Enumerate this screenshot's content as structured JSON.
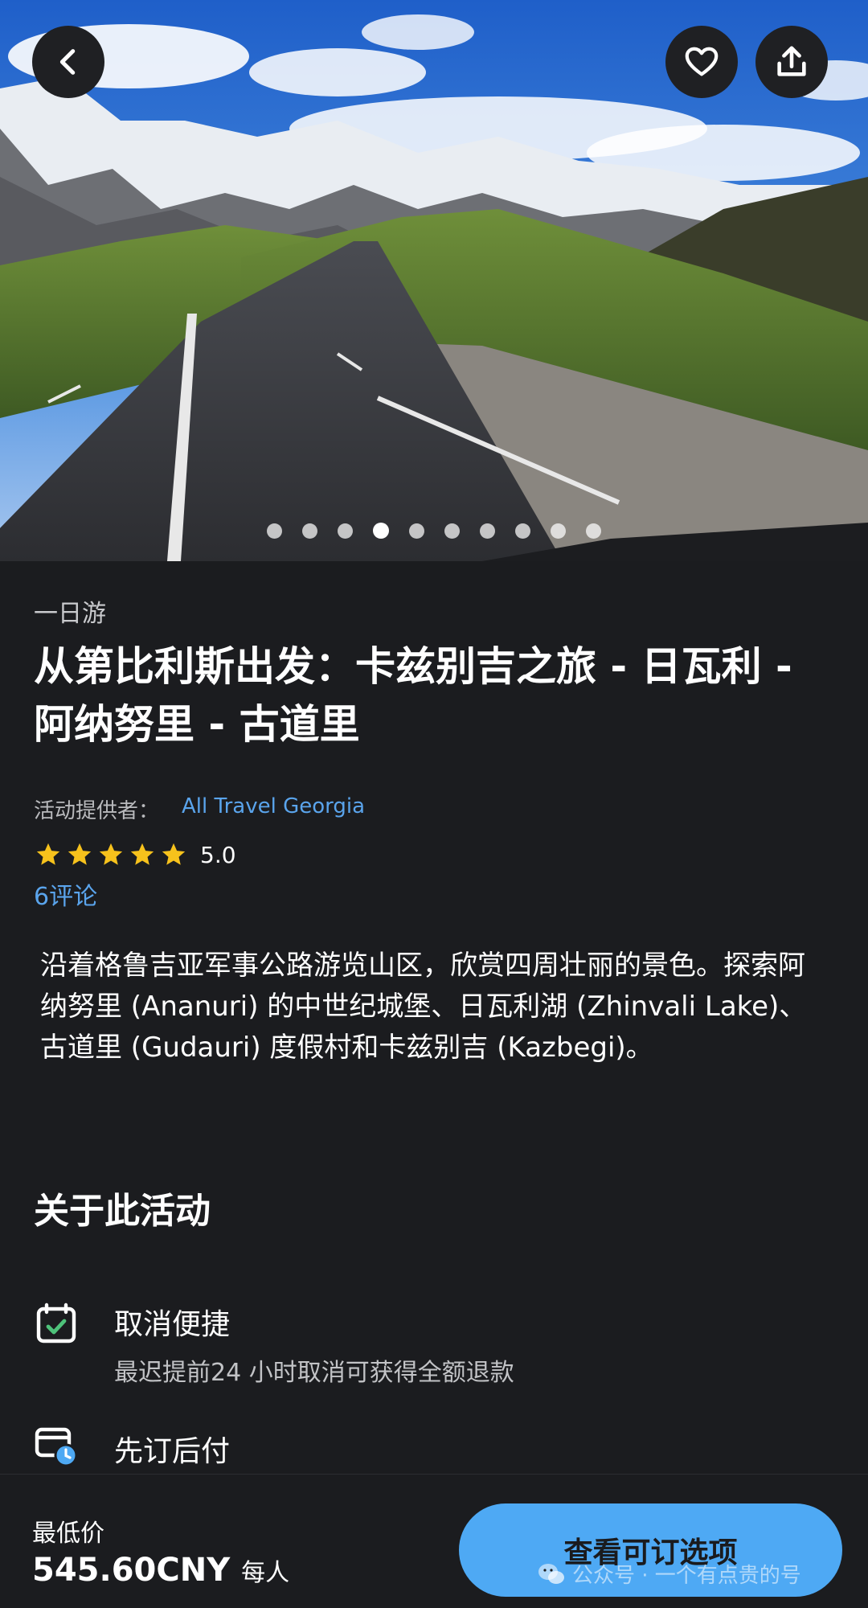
{
  "hero": {
    "image_alt": "mountain road",
    "carousel_total": 10,
    "carousel_active_index": 3
  },
  "category": "一日游",
  "title": "从第比利斯出发：卡兹别吉之旅 - 日瓦利 - 阿纳努里 - 古道里",
  "provider": {
    "label": "活动提供者：",
    "name": "All Travel Georgia"
  },
  "rating": {
    "stars": 5,
    "score": "5.0",
    "reviews": "6评论"
  },
  "description": "沿着格鲁吉亚军事公路游览山区，欣赏四周壮丽的景色。探索阿纳努里 (Ananuri) 的中世纪城堡、日瓦利湖 (Zhinvali Lake)、古道里 (Gudauri) 度假村和卡兹别吉 (Kazbegi)。",
  "about": {
    "title": "关于此活动",
    "features": [
      {
        "icon": "calendar-check-icon",
        "title": "取消便捷",
        "subtitle": "最迟提前24 小时取消可获得全额退款"
      },
      {
        "icon": "card-clock-icon",
        "title": "先订后付",
        "subtitle": ""
      }
    ]
  },
  "booking": {
    "price_label": "最低价",
    "price": "545.60CNY",
    "price_unit": "每人",
    "cta": "查看可订选项"
  },
  "watermark": "公众号 · 一个有点贵的号",
  "colors": {
    "background": "#1b1c1f",
    "link": "#5aa4ec",
    "star": "#f7c21c",
    "cta": "#4ea9f4"
  }
}
